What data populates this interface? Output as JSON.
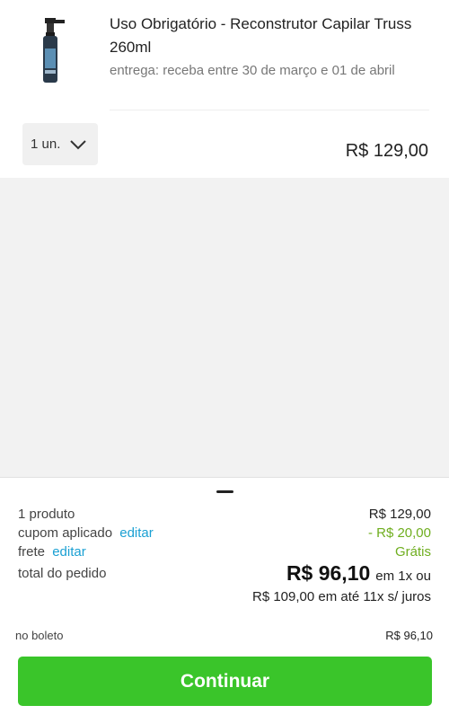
{
  "product": {
    "title": "Uso Obrigatório - Reconstrutor Capilar Truss 260ml",
    "delivery": "entrega: receba entre 30 de março e 01 de abril",
    "quantity": "1 un.",
    "price": "R$ 129,00",
    "image_icon": "spray-bottle-icon"
  },
  "summary": {
    "products_label": "1 produto",
    "products_value": "R$ 129,00",
    "coupon_label": "cupom aplicado",
    "coupon_edit": "editar",
    "coupon_value": "- R$ 20,00",
    "shipping_label": "frete",
    "shipping_edit": "editar",
    "shipping_value": "Grátis",
    "total_label": "total do pedido",
    "total_amount": "R$ 96,10",
    "total_suffix": "em 1x ou",
    "installments": "R$ 109,00 em até 11x s/ juros",
    "boleto_label": "no boleto",
    "boleto_value": "R$ 96,10",
    "continue_label": "Continuar"
  },
  "colors": {
    "accent_link": "#1aa0d3",
    "discount_green": "#6fae1f",
    "cta_green": "#3ac52a"
  }
}
